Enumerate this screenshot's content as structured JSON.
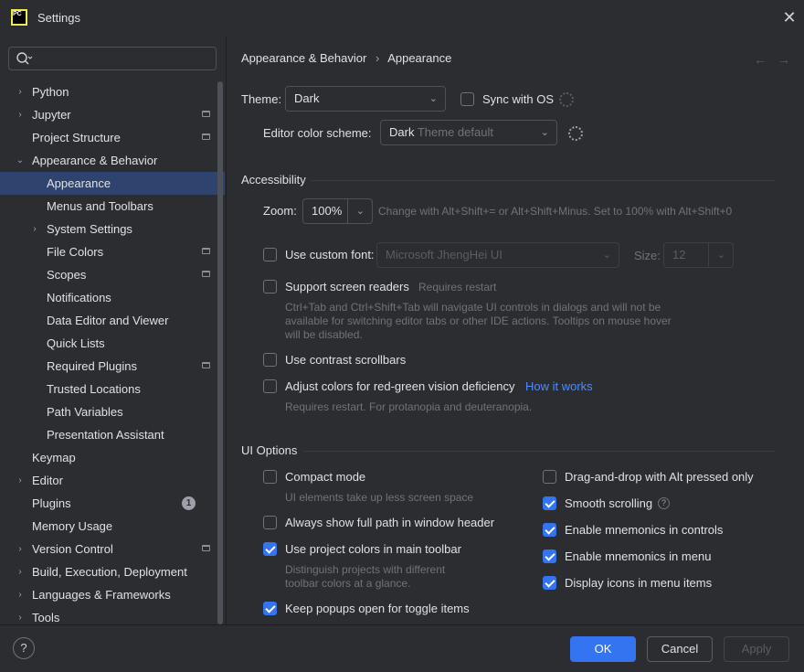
{
  "window": {
    "title": "Settings",
    "close_glyph": "✕",
    "logo_text": "PC"
  },
  "search": {
    "placeholder": ""
  },
  "tree": [
    {
      "label": "Python",
      "level": 0,
      "expand": "›"
    },
    {
      "label": "Jupyter",
      "level": 0,
      "expand": "›",
      "icon": true
    },
    {
      "label": "Project Structure",
      "level": 0,
      "icon": true
    },
    {
      "label": "Appearance & Behavior",
      "level": 0,
      "expand": "⌄"
    },
    {
      "label": "Appearance",
      "level": 1,
      "selected": true
    },
    {
      "label": "Menus and Toolbars",
      "level": 1
    },
    {
      "label": "System Settings",
      "level": 1,
      "expand": "›"
    },
    {
      "label": "File Colors",
      "level": 1,
      "icon": true
    },
    {
      "label": "Scopes",
      "level": 1,
      "icon": true
    },
    {
      "label": "Notifications",
      "level": 1
    },
    {
      "label": "Data Editor and Viewer",
      "level": 1
    },
    {
      "label": "Quick Lists",
      "level": 1
    },
    {
      "label": "Required Plugins",
      "level": 1,
      "icon": true
    },
    {
      "label": "Trusted Locations",
      "level": 1
    },
    {
      "label": "Path Variables",
      "level": 1
    },
    {
      "label": "Presentation Assistant",
      "level": 1
    },
    {
      "label": "Keymap",
      "level": 0
    },
    {
      "label": "Editor",
      "level": 0,
      "expand": "›"
    },
    {
      "label": "Plugins",
      "level": 0,
      "badge": "1"
    },
    {
      "label": "Memory Usage",
      "level": 0
    },
    {
      "label": "Version Control",
      "level": 0,
      "expand": "›",
      "icon": true
    },
    {
      "label": "Build, Execution, Deployment",
      "level": 0,
      "expand": "›"
    },
    {
      "label": "Languages & Frameworks",
      "level": 0,
      "expand": "›"
    },
    {
      "label": "Tools",
      "level": 0,
      "expand": "›"
    }
  ],
  "breadcrumb": {
    "parent": "Appearance & Behavior",
    "separator": "›",
    "current": "Appearance",
    "back": "←",
    "forward": "→"
  },
  "theme": {
    "label": "Theme:",
    "value": "Dark",
    "sync_label": "Sync with OS",
    "sync_checked": false
  },
  "scheme": {
    "label": "Editor color scheme:",
    "value": "Dark",
    "value_suffix": "Theme default"
  },
  "accessibility": {
    "title": "Accessibility",
    "zoom_label": "Zoom:",
    "zoom_value": "100%",
    "zoom_hint": "Change with Alt+Shift+= or Alt+Shift+Minus. Set to 100% with Alt+Shift+0",
    "custom_font_label": "Use custom font:",
    "custom_font_checked": false,
    "font_value": "Microsoft JhengHei UI",
    "size_label": "Size:",
    "size_value": "12",
    "screen_readers_label": "Support screen readers",
    "screen_readers_checked": false,
    "screen_readers_note": "Requires restart",
    "screen_readers_desc": [
      "Ctrl+Tab and Ctrl+Shift+Tab will navigate UI controls in dialogs and will not be",
      "available for switching editor tabs or other IDE actions. Tooltips on mouse hover",
      "will be disabled."
    ],
    "contrast_label": "Use contrast scrollbars",
    "contrast_checked": false,
    "red_green_label": "Adjust colors for red-green vision deficiency",
    "red_green_checked": false,
    "how_it_works": "How it works",
    "red_green_desc": "Requires restart. For protanopia and deuteranopia."
  },
  "ui_options": {
    "title": "UI Options",
    "compact_label": "Compact mode",
    "compact_checked": false,
    "compact_desc": "UI elements take up less screen space",
    "full_path_label": "Always show full path in window header",
    "full_path_checked": false,
    "project_colors_label": "Use project colors in main toolbar",
    "project_colors_checked": true,
    "project_colors_desc": [
      "Distinguish projects with different",
      "toolbar colors at a glance."
    ],
    "keep_popups_label": "Keep popups open for toggle items",
    "keep_popups_checked": true,
    "drag_drop_label": "Drag-and-drop with Alt pressed only",
    "drag_drop_checked": false,
    "smooth_label": "Smooth scrolling",
    "smooth_checked": true,
    "mnemonics_controls_label": "Enable mnemonics in controls",
    "mnemonics_controls_checked": true,
    "mnemonics_menu_label": "Enable mnemonics in menu",
    "mnemonics_menu_checked": true,
    "display_icons_label": "Display icons in menu items",
    "display_icons_checked": true
  },
  "footer": {
    "help": "?",
    "ok": "OK",
    "cancel": "Cancel",
    "apply": "Apply"
  },
  "colors": {
    "background": "#2b2d30",
    "accent": "#3574f0",
    "selection": "#2e436e",
    "link": "#548af7"
  }
}
